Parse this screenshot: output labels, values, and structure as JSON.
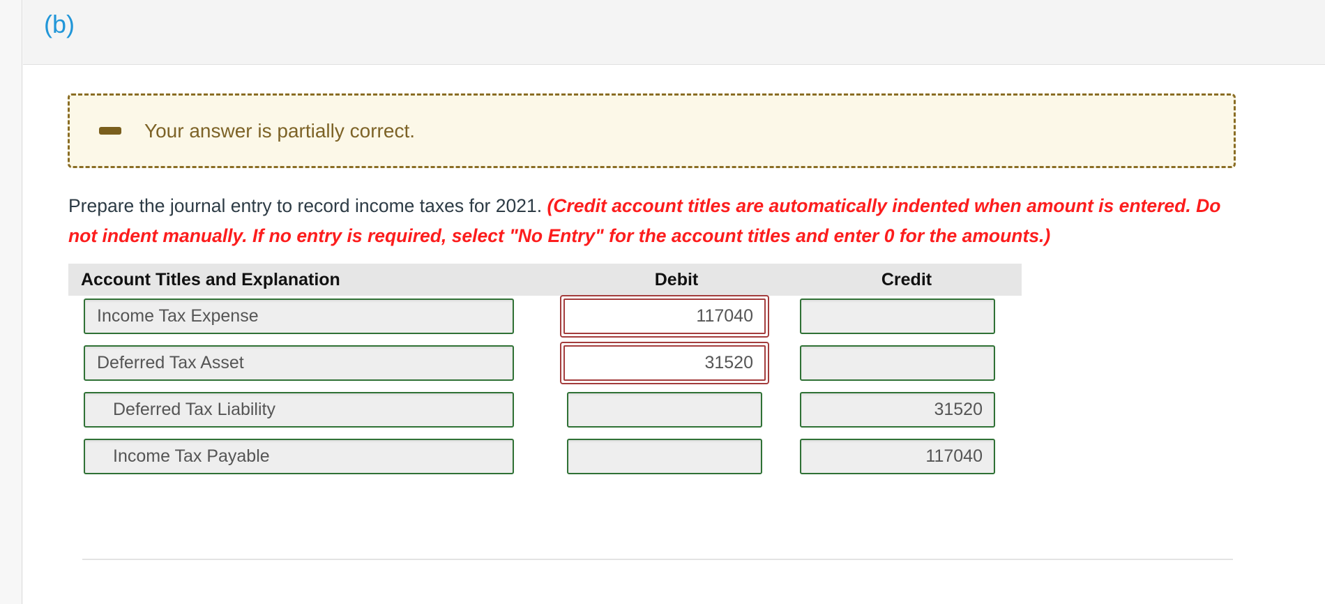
{
  "part": {
    "label": "(b)"
  },
  "alert": {
    "icon": "dash-icon",
    "message": "Your answer is partially correct.",
    "border_color": "#8a6d24",
    "background_color": "#fcf8e8",
    "text_color": "#7d6327"
  },
  "instructions": {
    "lead": "Prepare the journal entry to record income taxes for 2021.",
    "emphasis": "(Credit account titles are automatically indented when amount is entered. Do not indent manually. If no entry is required, select \"No Entry\" for the account titles and enter 0 for the amounts.)",
    "emphasis_color": "#fc1d1d"
  },
  "journal": {
    "headers": {
      "account": "Account Titles and Explanation",
      "debit": "Debit",
      "credit": "Credit"
    },
    "rows": [
      {
        "account": "Income Tax Expense",
        "indented": false,
        "debit": "117040",
        "credit": "",
        "debit_state": "error",
        "credit_state": "normal"
      },
      {
        "account": "Deferred Tax Asset",
        "indented": false,
        "debit": "31520",
        "credit": "",
        "debit_state": "error",
        "credit_state": "normal"
      },
      {
        "account": "Deferred Tax Liability",
        "indented": true,
        "debit": "",
        "credit": "31520",
        "debit_state": "normal",
        "credit_state": "normal"
      },
      {
        "account": "Income Tax Payable",
        "indented": true,
        "debit": "",
        "credit": "117040",
        "debit_state": "normal",
        "credit_state": "normal"
      }
    ],
    "colors": {
      "field_border_ok": "#2f7135",
      "field_border_error": "#a33c3c",
      "field_background": "#eeeeee",
      "header_background": "#e6e6e6"
    }
  }
}
